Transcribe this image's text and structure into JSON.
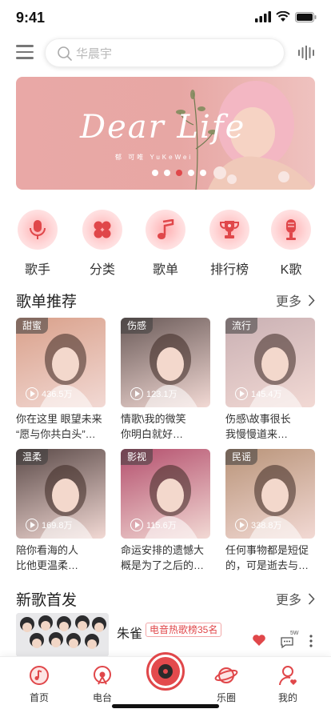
{
  "status": {
    "time": "9:41"
  },
  "search": {
    "placeholder": "华晨宇"
  },
  "banner": {
    "title": "Dear Life",
    "subtitle": "郁 可唯  YuKeWei",
    "dot_count": 5,
    "active_dot": 2
  },
  "categories": [
    {
      "label": "歌手",
      "icon": "microphone-icon"
    },
    {
      "label": "分类",
      "icon": "clover-icon"
    },
    {
      "label": "歌单",
      "icon": "music-note-icon"
    },
    {
      "label": "排行榜",
      "icon": "trophy-icon"
    },
    {
      "label": "K歌",
      "icon": "mic-stand-icon"
    }
  ],
  "playlist_section": {
    "title": "歌单推荐",
    "more": "更多"
  },
  "playlists": [
    {
      "tag": "甜蜜",
      "plays": "436.5万",
      "line1": "你在这里 眼望未来",
      "line2": "“愿与你共白头”…",
      "bg": "#d9a08a"
    },
    {
      "tag": "伤感",
      "plays": "123.1万",
      "line1": "情歌\\我的微笑",
      "line2": "你明白就好…",
      "bg": "#6a5a58"
    },
    {
      "tag": "流行",
      "plays": "145.4万",
      "line1": "伤感\\故事很长",
      "line2": "我慢慢道来…",
      "bg": "#c9b0b3"
    },
    {
      "tag": "温柔",
      "plays": "169.8万",
      "line1": "陪你看海的人",
      "line2": "比他更温柔…",
      "bg": "#5b4a48"
    },
    {
      "tag": "影视",
      "plays": "115.6万",
      "line1": "命运安排的遗憾大",
      "line2": "概是为了之后的…",
      "bg": "#b44f6d"
    },
    {
      "tag": "民谣",
      "plays": "338.8万",
      "line1": "任何事物都是短促",
      "line2": "的，可是逝去与…",
      "bg": "#b99479"
    }
  ],
  "newsong_section": {
    "title": "新歌首发",
    "more": "更多"
  },
  "newsong": {
    "name": "朱雀",
    "chart_tag": "电音热歌榜35名",
    "comment_count": "5W"
  },
  "tabs": [
    {
      "label": "首页",
      "icon": "home-disc-icon"
    },
    {
      "label": "电台",
      "icon": "radio-icon"
    },
    {
      "label": "",
      "icon": "player-disc-icon"
    },
    {
      "label": "乐圈",
      "icon": "planet-icon"
    },
    {
      "label": "我的",
      "icon": "user-icon"
    }
  ],
  "colors": {
    "accent": "#e0474a",
    "banner": "#e9a8a6"
  }
}
